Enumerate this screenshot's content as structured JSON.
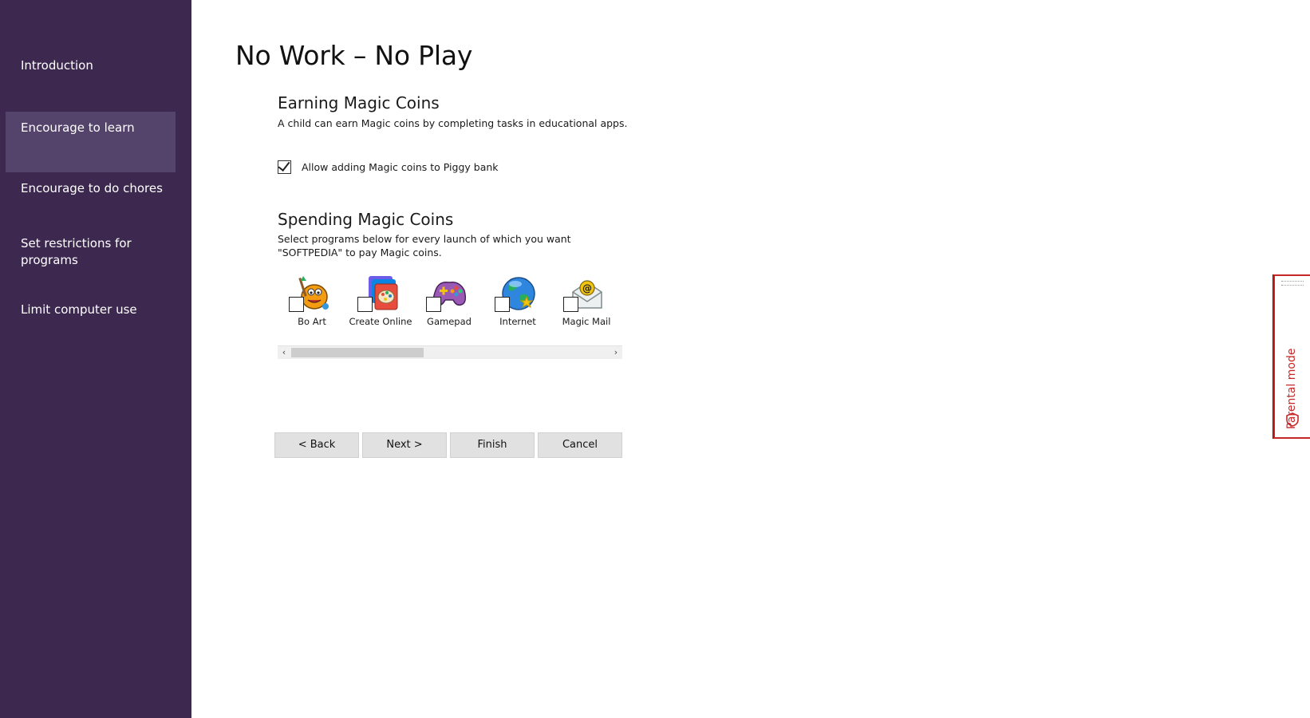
{
  "sidebar": {
    "items": [
      {
        "label": "Introduction"
      },
      {
        "label": "Encourage to learn"
      },
      {
        "label": "Encourage to do chores"
      },
      {
        "label": "Set restrictions for programs"
      },
      {
        "label": "Limit computer use"
      }
    ],
    "active_index": 1,
    "background": "#3d2950",
    "active_background": "#54436a"
  },
  "page": {
    "title": "No Work – No Play"
  },
  "earning": {
    "title": "Earning Magic Coins",
    "description": "A child can earn Magic coins by completing tasks in educational apps.",
    "checkbox_label": "Allow adding Magic coins to Piggy bank",
    "checkbox_checked": true
  },
  "spending": {
    "title": "Spending Magic Coins",
    "description": "Select programs below for every launch of which you want \"SOFTPEDIA\" to pay Magic coins.",
    "programs": [
      {
        "label": "Bo Art",
        "icon": "bo-art-icon",
        "checked": false
      },
      {
        "label": "Create Online",
        "icon": "create-online-icon",
        "checked": false
      },
      {
        "label": "Gamepad",
        "icon": "gamepad-icon",
        "checked": false
      },
      {
        "label": "Internet",
        "icon": "internet-icon",
        "checked": false
      },
      {
        "label": "Magic Mail",
        "icon": "magic-mail-icon",
        "checked": false
      }
    ]
  },
  "buttons": {
    "back": "< Back",
    "next": "Next >",
    "finish": "Finish",
    "cancel": "Cancel"
  },
  "parental_tab": {
    "label": "Parental mode",
    "accent": "#c62828"
  }
}
